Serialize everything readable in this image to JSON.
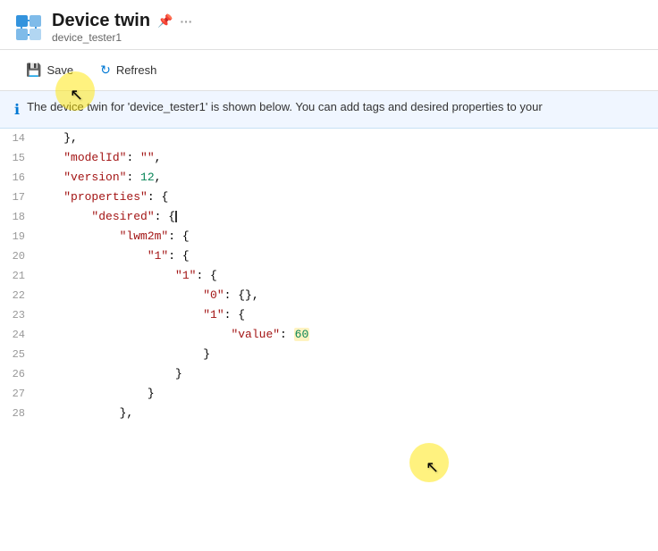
{
  "header": {
    "title": "Device twin",
    "subtitle": "device_tester1",
    "pin_label": "Pin",
    "more_label": "More options"
  },
  "toolbar": {
    "save_label": "Save",
    "refresh_label": "Refresh"
  },
  "info_banner": {
    "text": "The device twin for 'device_tester1' is shown below. You can add tags and desired properties to your"
  },
  "code": {
    "lines": [
      {
        "num": 14,
        "content": "    },"
      },
      {
        "num": 15,
        "content": "    \"modelId\": \"\","
      },
      {
        "num": 16,
        "content": "    \"version\": 12,"
      },
      {
        "num": 17,
        "content": "    \"properties\": {"
      },
      {
        "num": 18,
        "content": "        \"desired\": {"
      },
      {
        "num": 19,
        "content": "            \"lwm2m\": {"
      },
      {
        "num": 20,
        "content": "                \"1\": {"
      },
      {
        "num": 21,
        "content": "                    \"1\": {"
      },
      {
        "num": 22,
        "content": "                        \"0\": {},"
      },
      {
        "num": 23,
        "content": "                        \"1\": {"
      },
      {
        "num": 24,
        "content": "                            \"value\": 60"
      },
      {
        "num": 25,
        "content": "                        }"
      },
      {
        "num": 26,
        "content": "                    }"
      },
      {
        "num": 27,
        "content": "                }"
      },
      {
        "num": 28,
        "content": "            },"
      }
    ]
  },
  "colors": {
    "accent": "#0078d4",
    "key_color": "#a31515",
    "number_color": "#098658",
    "text_color": "#333"
  }
}
